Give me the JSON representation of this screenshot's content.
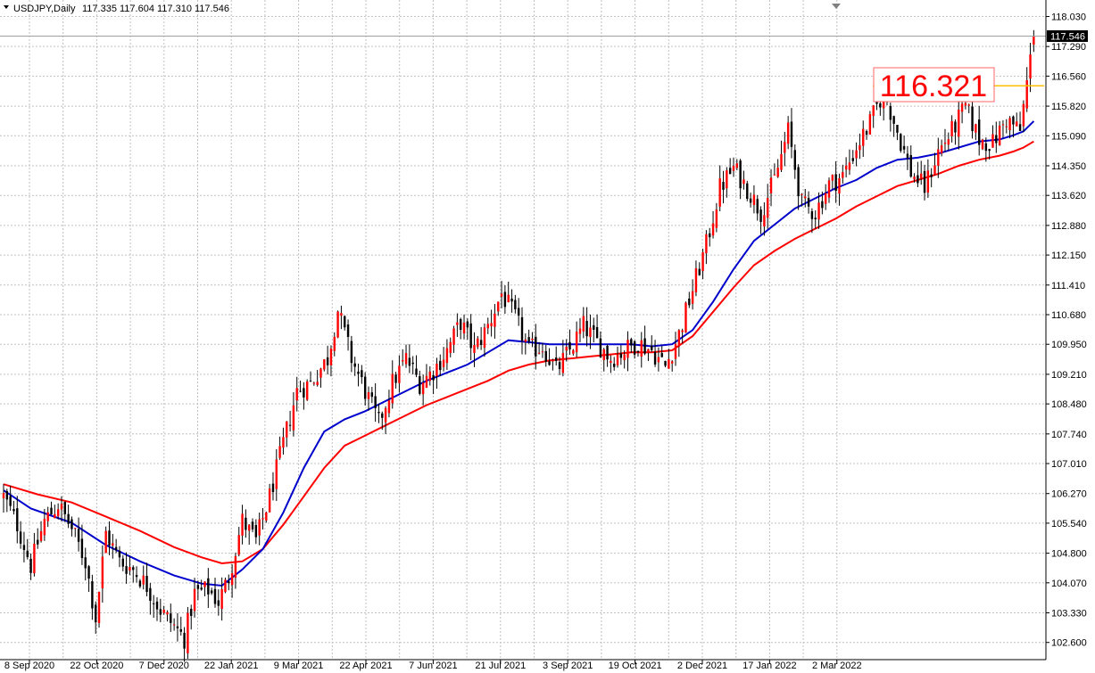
{
  "header": {
    "symbol": "USDJPY,Daily",
    "ohlc": "117.335 117.604 117.310 117.546"
  },
  "colors": {
    "background": "#ffffff",
    "grid": "#c0c0c0",
    "candle": "#ff0000",
    "wick": "#000000",
    "ma_fast": "#0000cc",
    "ma_slow": "#ff0000",
    "level_line": "#ffc000",
    "price_tag_bg": "#000000"
  },
  "annotation": {
    "value": "116.321",
    "price": 116.321
  },
  "current_price": {
    "label": "117.546",
    "value": 117.546
  },
  "chart_data": {
    "type": "candlestick",
    "ylim": [
      102.25,
      118.4
    ],
    "y_ticks": [
      "118.030",
      "117.290",
      "116.560",
      "115.820",
      "115.090",
      "114.350",
      "113.620",
      "112.880",
      "112.150",
      "111.410",
      "110.680",
      "109.950",
      "109.210",
      "108.480",
      "107.740",
      "107.010",
      "106.270",
      "105.540",
      "104.800",
      "104.070",
      "103.330",
      "102.600"
    ],
    "y_tick_values": [
      118.03,
      117.29,
      116.56,
      115.82,
      115.09,
      114.35,
      113.62,
      112.88,
      112.15,
      111.41,
      110.68,
      109.95,
      109.21,
      108.48,
      107.74,
      107.01,
      106.27,
      105.54,
      104.8,
      104.07,
      103.33,
      102.6
    ],
    "x_ticks": [
      "8 Sep 2020",
      "22 Oct 2020",
      "7 Dec 2020",
      "22 Jan 2021",
      "9 Mar 2021",
      "22 Apr 2021",
      "7 Jun 2021",
      "21 Jul 2021",
      "3 Sep 2021",
      "19 Oct 2021",
      "2 Dec 2021",
      "17 Jan 2022",
      "2 Mar 2022"
    ],
    "close_path": [
      [
        0,
        106.2
      ],
      [
        4,
        105.5
      ],
      [
        8,
        104.5
      ],
      [
        12,
        105.6
      ],
      [
        16,
        106.0
      ],
      [
        20,
        105.4
      ],
      [
        24,
        104.6
      ],
      [
        27,
        103.2
      ],
      [
        30,
        105.3
      ],
      [
        34,
        104.6
      ],
      [
        38,
        104.4
      ],
      [
        42,
        104.0
      ],
      [
        46,
        103.4
      ],
      [
        50,
        103.0
      ],
      [
        53,
        102.7
      ],
      [
        56,
        103.8
      ],
      [
        60,
        103.9
      ],
      [
        63,
        103.6
      ],
      [
        66,
        104.2
      ],
      [
        70,
        105.6
      ],
      [
        74,
        105.1
      ],
      [
        78,
        106.2
      ],
      [
        82,
        107.5
      ],
      [
        86,
        108.8
      ],
      [
        90,
        109.0
      ],
      [
        95,
        109.6
      ],
      [
        98,
        110.8
      ],
      [
        102,
        109.6
      ],
      [
        106,
        108.8
      ],
      [
        110,
        108.0
      ],
      [
        114,
        109.0
      ],
      [
        118,
        109.6
      ],
      [
        122,
        109.0
      ],
      [
        126,
        109.3
      ],
      [
        130,
        109.8
      ],
      [
        134,
        110.5
      ],
      [
        138,
        109.8
      ],
      [
        142,
        110.4
      ],
      [
        146,
        111.2
      ],
      [
        150,
        110.6
      ],
      [
        154,
        109.8
      ],
      [
        158,
        109.9
      ],
      [
        162,
        109.3
      ],
      [
        166,
        109.8
      ],
      [
        170,
        110.4
      ],
      [
        174,
        110.0
      ],
      [
        178,
        109.6
      ],
      [
        182,
        109.8
      ],
      [
        186,
        110.0
      ],
      [
        190,
        109.8
      ],
      [
        194,
        109.4
      ],
      [
        198,
        110.2
      ],
      [
        202,
        111.3
      ],
      [
        206,
        112.4
      ],
      [
        210,
        113.8
      ],
      [
        214,
        114.3
      ],
      [
        218,
        113.8
      ],
      [
        222,
        113.2
      ],
      [
        226,
        114.0
      ],
      [
        230,
        115.2
      ],
      [
        234,
        113.4
      ],
      [
        238,
        113.2
      ],
      [
        242,
        113.9
      ],
      [
        246,
        114.1
      ],
      [
        250,
        114.8
      ],
      [
        254,
        115.4
      ],
      [
        258,
        116.2
      ],
      [
        262,
        115.2
      ],
      [
        266,
        114.2
      ],
      [
        270,
        113.8
      ],
      [
        274,
        114.7
      ],
      [
        278,
        115.2
      ],
      [
        282,
        115.8
      ],
      [
        286,
        115.0
      ],
      [
        290,
        114.9
      ],
      [
        294,
        115.5
      ],
      [
        298,
        115.2
      ],
      [
        300,
        116.4
      ],
      [
        302,
        117.546
      ]
    ],
    "ma_fast": [
      [
        0,
        106.35
      ],
      [
        8,
        105.9
      ],
      [
        20,
        105.55
      ],
      [
        30,
        105.0
      ],
      [
        40,
        104.6
      ],
      [
        50,
        104.25
      ],
      [
        58,
        104.05
      ],
      [
        64,
        104.0
      ],
      [
        70,
        104.4
      ],
      [
        76,
        104.9
      ],
      [
        82,
        105.8
      ],
      [
        88,
        106.9
      ],
      [
        94,
        107.8
      ],
      [
        100,
        108.1
      ],
      [
        106,
        108.3
      ],
      [
        112,
        108.55
      ],
      [
        118,
        108.8
      ],
      [
        124,
        109.05
      ],
      [
        130,
        109.25
      ],
      [
        136,
        109.45
      ],
      [
        142,
        109.75
      ],
      [
        148,
        110.05
      ],
      [
        154,
        110.0
      ],
      [
        160,
        109.95
      ],
      [
        166,
        109.95
      ],
      [
        172,
        109.95
      ],
      [
        178,
        109.95
      ],
      [
        184,
        109.95
      ],
      [
        190,
        109.9
      ],
      [
        196,
        109.95
      ],
      [
        202,
        110.3
      ],
      [
        208,
        111.0
      ],
      [
        214,
        111.8
      ],
      [
        220,
        112.5
      ],
      [
        226,
        112.9
      ],
      [
        232,
        113.3
      ],
      [
        238,
        113.55
      ],
      [
        244,
        113.8
      ],
      [
        250,
        114.0
      ],
      [
        256,
        114.3
      ],
      [
        262,
        114.5
      ],
      [
        268,
        114.55
      ],
      [
        274,
        114.65
      ],
      [
        280,
        114.8
      ],
      [
        286,
        114.95
      ],
      [
        292,
        115.0
      ],
      [
        296,
        115.1
      ],
      [
        299,
        115.2
      ],
      [
        302,
        115.45
      ]
    ],
    "ma_slow": [
      [
        0,
        106.5
      ],
      [
        10,
        106.25
      ],
      [
        20,
        106.05
      ],
      [
        30,
        105.7
      ],
      [
        40,
        105.35
      ],
      [
        50,
        104.95
      ],
      [
        58,
        104.7
      ],
      [
        64,
        104.55
      ],
      [
        70,
        104.6
      ],
      [
        76,
        104.9
      ],
      [
        82,
        105.5
      ],
      [
        88,
        106.2
      ],
      [
        94,
        106.9
      ],
      [
        100,
        107.45
      ],
      [
        106,
        107.7
      ],
      [
        112,
        107.95
      ],
      [
        118,
        108.2
      ],
      [
        124,
        108.45
      ],
      [
        130,
        108.65
      ],
      [
        136,
        108.85
      ],
      [
        142,
        109.05
      ],
      [
        148,
        109.3
      ],
      [
        154,
        109.45
      ],
      [
        160,
        109.55
      ],
      [
        166,
        109.6
      ],
      [
        172,
        109.65
      ],
      [
        178,
        109.7
      ],
      [
        184,
        109.75
      ],
      [
        190,
        109.75
      ],
      [
        196,
        109.8
      ],
      [
        202,
        110.15
      ],
      [
        208,
        110.75
      ],
      [
        214,
        111.35
      ],
      [
        220,
        111.9
      ],
      [
        226,
        112.25
      ],
      [
        232,
        112.55
      ],
      [
        238,
        112.8
      ],
      [
        244,
        113.05
      ],
      [
        250,
        113.35
      ],
      [
        256,
        113.6
      ],
      [
        262,
        113.85
      ],
      [
        268,
        114.0
      ],
      [
        274,
        114.15
      ],
      [
        280,
        114.35
      ],
      [
        286,
        114.5
      ],
      [
        292,
        114.6
      ],
      [
        296,
        114.7
      ],
      [
        299,
        114.8
      ],
      [
        302,
        114.95
      ]
    ]
  }
}
